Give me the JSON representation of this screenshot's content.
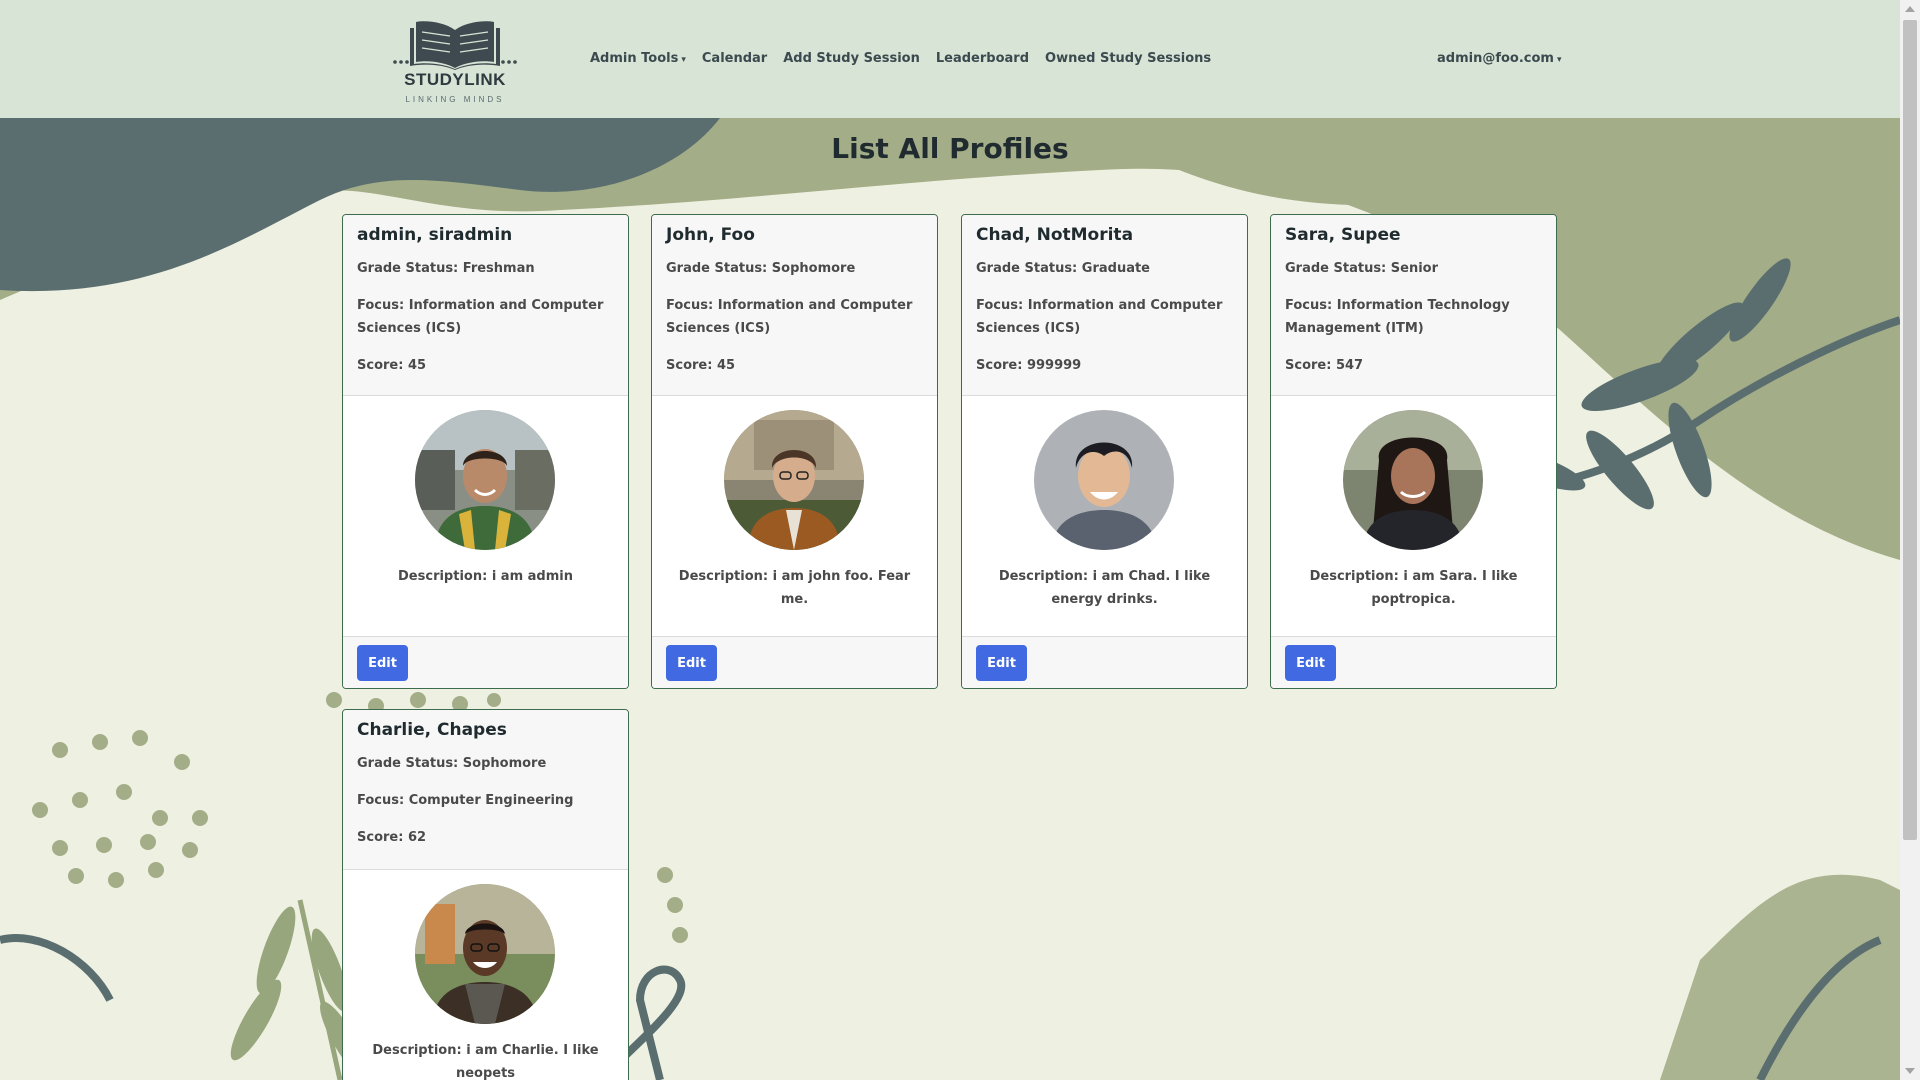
{
  "brand": {
    "name": "STUDYLINK",
    "tagline": "LINKING MINDS"
  },
  "nav": {
    "items": [
      {
        "label": "Admin Tools",
        "dropdown": true
      },
      {
        "label": "Calendar",
        "dropdown": false
      },
      {
        "label": "Add Study Session",
        "dropdown": false
      },
      {
        "label": "Leaderboard",
        "dropdown": false
      },
      {
        "label": "Owned Study Sessions",
        "dropdown": false
      }
    ],
    "user": "admin@foo.com"
  },
  "page": {
    "title": "List All Profiles"
  },
  "profiles": [
    {
      "name": "admin, siradmin",
      "grade": "Grade Status: Freshman",
      "focus": "Focus: Information and Computer Sciences (ICS)",
      "score": "Score: 45",
      "description": "Description: i am admin",
      "edit": "Edit"
    },
    {
      "name": "John, Foo",
      "grade": "Grade Status: Sophomore",
      "focus": "Focus: Information and Computer Sciences (ICS)",
      "score": "Score: 45",
      "description": "Description: i am john foo. Fear me.",
      "edit": "Edit"
    },
    {
      "name": "Chad, NotMorita",
      "grade": "Grade Status: Graduate",
      "focus": "Focus: Information and Computer Sciences (ICS)",
      "score": "Score: 999999",
      "description": "Description: i am Chad. I like energy drinks.",
      "edit": "Edit"
    },
    {
      "name": "Sara, Supee",
      "grade": "Grade Status: Senior",
      "focus": "Focus: Information Technology Management (ITM)",
      "score": "Score: 547",
      "description": "Description: i am Sara. I like poptropica.",
      "edit": "Edit"
    },
    {
      "name": "Charlie, Chapes",
      "grade": "Grade Status: Sophomore",
      "focus": "Focus: Computer Engineering",
      "score": "Score: 62",
      "description": "Description: i am Charlie. I like neopets",
      "edit": "Edit"
    }
  ],
  "colors": {
    "navbar": "#d8e4d6",
    "accent": "#4169e1",
    "card_border": "#3d6b4d",
    "bg_dark": "#5a6e70",
    "bg_sage": "#a3ad87"
  }
}
